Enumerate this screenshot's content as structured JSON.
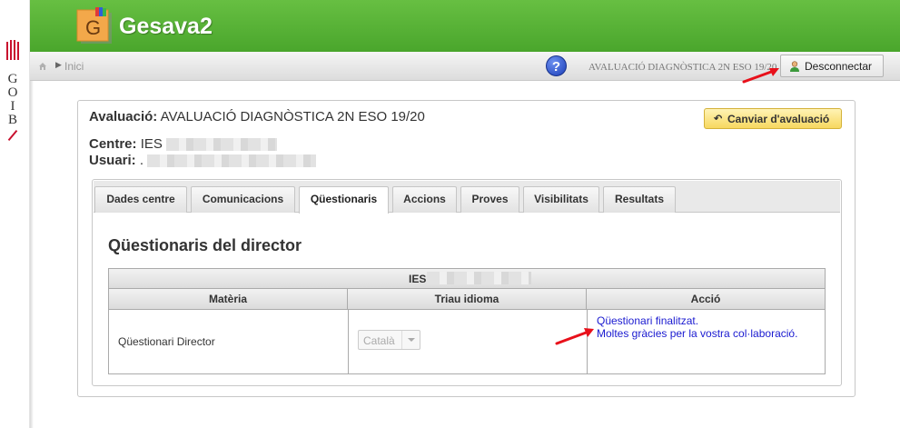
{
  "brand": {
    "letters": [
      "G",
      "O",
      "I",
      "B"
    ]
  },
  "app": {
    "title": "Gesava2",
    "logo_letter": "G"
  },
  "toolbar": {
    "breadcrumb": "Inici",
    "help_label": "?",
    "evaluation": "AVALUACIÓ DIAGNÒSTICA 2N ESO 19/20",
    "logout_label": "Desconnectar"
  },
  "info": {
    "evaluation_label": "Avaluació:",
    "evaluation_value": "AVALUACIÓ DIAGNÒSTICA 2N ESO 19/20",
    "centre_label": "Centre:",
    "centre_value": "IES",
    "user_label": "Usuari:",
    "user_value": "."
  },
  "change_button": {
    "icon": "undo-arrow-icon",
    "label": "Canviar d'avaluació"
  },
  "tabs": [
    {
      "label": "Dades centre"
    },
    {
      "label": "Comunicacions"
    },
    {
      "label": "Qüestionaris"
    },
    {
      "label": "Accions"
    },
    {
      "label": "Proves"
    },
    {
      "label": "Visibilitats"
    },
    {
      "label": "Resultats"
    }
  ],
  "active_tab": "Qüestionaris",
  "section": {
    "title": "Qüestionaris del director"
  },
  "table": {
    "group_header": "IES",
    "headers": [
      "Matèria",
      "Triau idioma",
      "Acció"
    ],
    "row": {
      "materia": "Qüestionari Director",
      "idioma": "Català",
      "accio_line1": "Qüestionari finalitzat.",
      "accio_line2": "Moltes gràcies per la vostra col·laboració."
    }
  },
  "colors": {
    "header_green": "#4aa62c",
    "annotation_red": "#e8101a",
    "link_blue": "#1a1ad0",
    "button_yellow": "#f7d860"
  }
}
